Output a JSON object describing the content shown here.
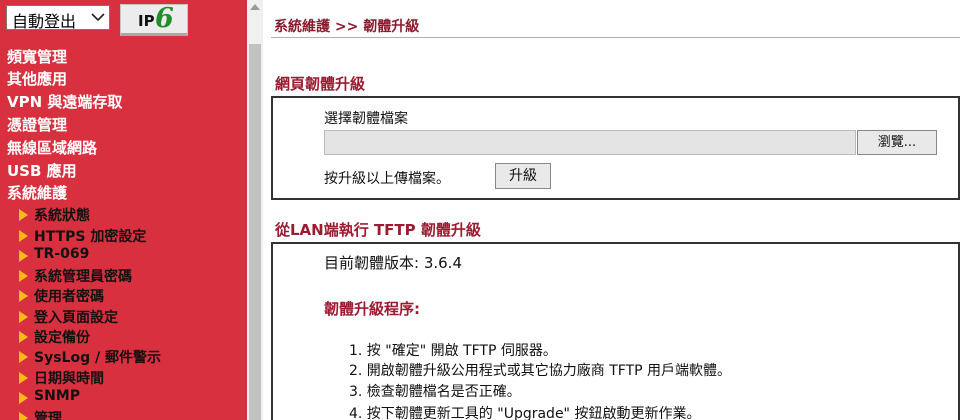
{
  "header": {
    "logout_select": {
      "value": "自動登出"
    },
    "ipv6_badge": {
      "prefix": "IP",
      "suffix": "6"
    }
  },
  "sidebar": {
    "main_items": [
      {
        "label": "頻寬管理"
      },
      {
        "label": "其他應用"
      },
      {
        "label": "VPN 與遠端存取"
      },
      {
        "label": "憑證管理"
      },
      {
        "label": "無線區域網路"
      },
      {
        "label": "USB 應用"
      },
      {
        "label": "系統維護"
      }
    ],
    "sub_items": [
      {
        "label": "系統狀態"
      },
      {
        "label": "HTTPS 加密設定"
      },
      {
        "label": "TR-069"
      },
      {
        "label": "系統管理員密碼"
      },
      {
        "label": "使用者密碼"
      },
      {
        "label": "登入頁面設定"
      },
      {
        "label": "設定備份"
      },
      {
        "label": "SysLog / 郵件警示"
      },
      {
        "label": "日期與時間"
      },
      {
        "label": "SNMP"
      },
      {
        "label": "管理"
      }
    ]
  },
  "main": {
    "breadcrumb": "系統維護 >> 韌體升級",
    "web_upgrade": {
      "title": "網頁韌體升級",
      "select_label": "選擇韌體檔案",
      "browse_label": "瀏覽...",
      "hint": "按升級以上傳檔案。",
      "upgrade_label": "升級"
    },
    "tftp_upgrade": {
      "title": "從LAN端執行 TFTP 韌體升級",
      "current_version": "目前韌體版本: 3.6.4",
      "procedure_title": "韌體升級程序:",
      "steps": [
        "1.  按 \"確定\" 開啟 TFTP 伺服器。",
        "2.  開啟韌體升級公用程式或其它協力廠商 TFTP 用戶端軟體。",
        "3.  檢查韌體檔名是否正確。",
        "4.  按下韌體更新工具的 \"Upgrade\" 按鈕啟動更新作業。"
      ]
    }
  },
  "colors": {
    "sidebar_bg": "#d9303f",
    "accent": "#9b1b30",
    "submenu_marker": "#f7bb18",
    "ipv6_green": "#1f8f2a"
  }
}
